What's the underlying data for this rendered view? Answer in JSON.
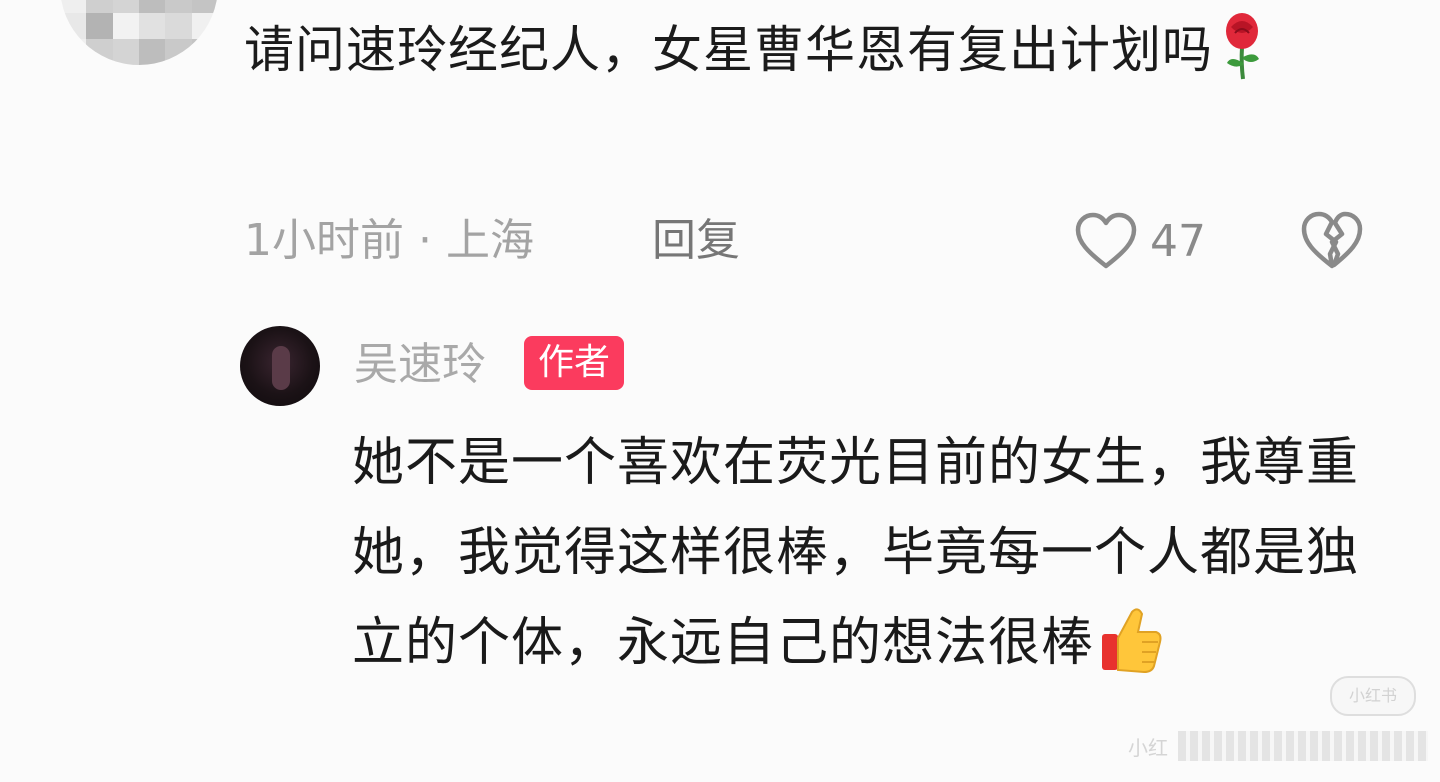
{
  "comment": {
    "text": "请问速玲经纪人，女星曹华恩有复出计划吗",
    "emoji_icon": "rose-icon",
    "time": "1小时前",
    "separator": "·",
    "location": "上海",
    "reply_label": "回复",
    "like_count": "47"
  },
  "reply": {
    "author": "吴速玲",
    "badge": "作者",
    "text": "她不是一个喜欢在荧光目前的女生，我尊重她，我觉得这样很棒，毕竟每一个人都是独立的个体，永远自己的想法很棒",
    "emoji_icon": "thumbs-up-icon"
  },
  "watermark": {
    "badge": "小红书",
    "corner": "小红"
  },
  "colors": {
    "badge_bg": "#fb3b5e",
    "meta_text": "#a3a3a3"
  }
}
